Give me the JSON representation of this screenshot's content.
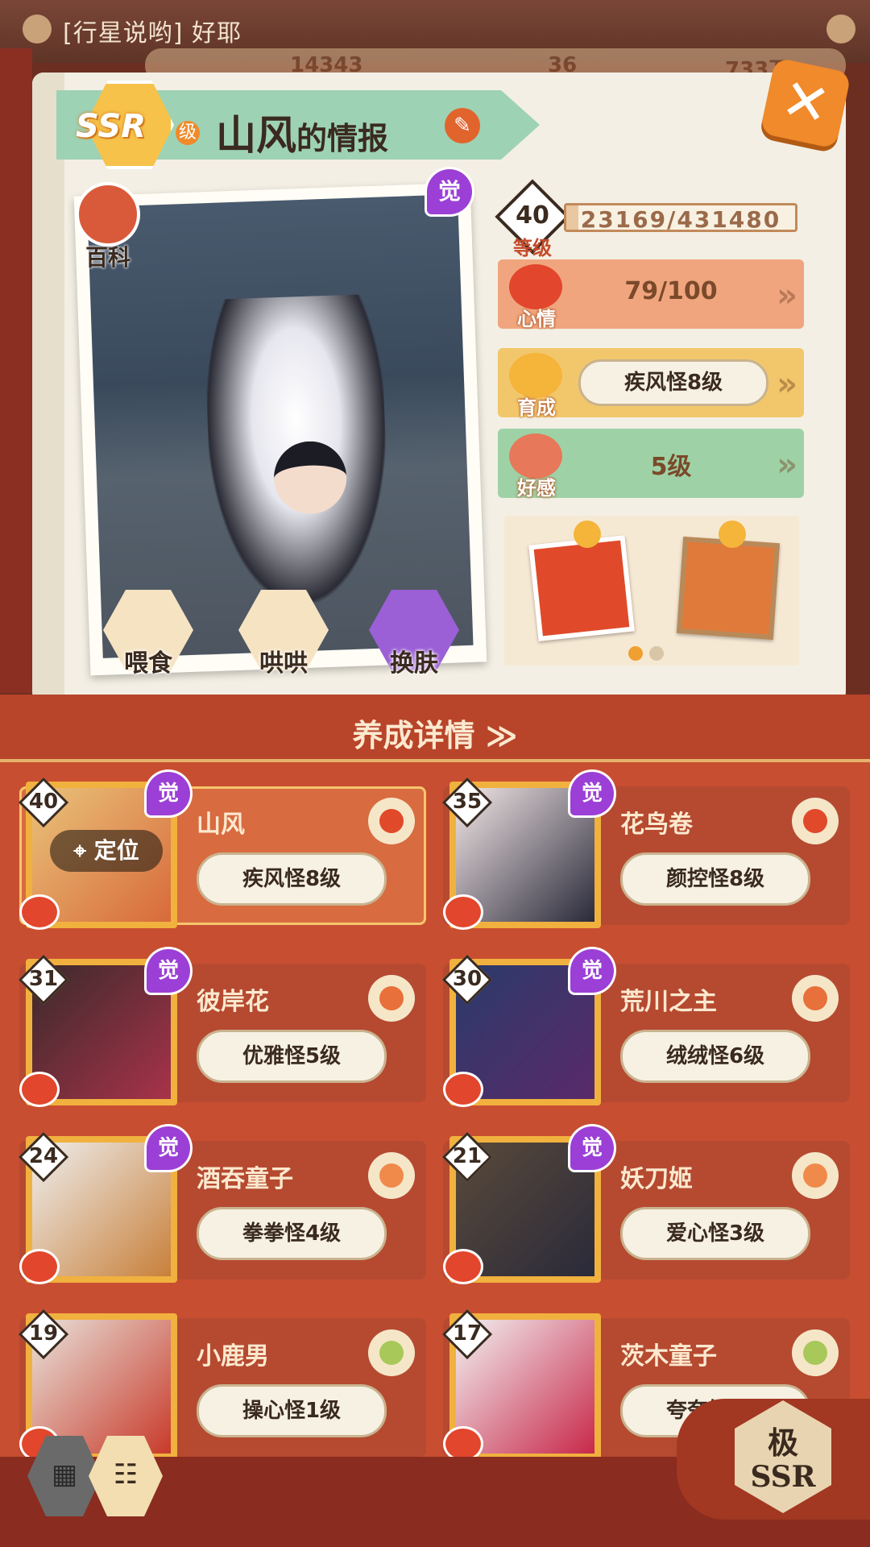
{
  "chat": {
    "text": "[行星说哟] 好耶"
  },
  "resources": {
    "a": "14343",
    "b": "36",
    "c": "733万"
  },
  "header": {
    "rank_label": "SSR",
    "rank_suffix": "级",
    "title_main": "山风",
    "title_tail": "的情报"
  },
  "portrait": {
    "awaken_label": "觉",
    "baike_label": "百科"
  },
  "actions": [
    {
      "label": "喂食"
    },
    {
      "label": "哄哄"
    },
    {
      "label": "换肤"
    }
  ],
  "level": {
    "value": "40",
    "label": "等级",
    "exp_text": "23169/431480",
    "exp_current": 23169,
    "exp_max": 431480
  },
  "stats": {
    "mood": {
      "label": "心情",
      "value": "79/100"
    },
    "growth": {
      "label": "育成",
      "value": "疾风怪8级"
    },
    "affection": {
      "label": "好感",
      "value": "5级"
    }
  },
  "section": {
    "title": "养成详情 ≫"
  },
  "shikigami": [
    {
      "name": "山风",
      "level": "40",
      "trait": "疾风怪8级",
      "awakened": "觉",
      "locate": "定位"
    },
    {
      "name": "花鸟卷",
      "level": "35",
      "trait": "颜控怪8级",
      "awakened": "觉"
    },
    {
      "name": "彼岸花",
      "level": "31",
      "trait": "优雅怪5级",
      "awakened": "觉"
    },
    {
      "name": "荒川之主",
      "level": "30",
      "trait": "绒绒怪6级",
      "awakened": "觉"
    },
    {
      "name": "酒吞童子",
      "level": "24",
      "trait": "拳拳怪4级",
      "awakened": "觉"
    },
    {
      "name": "妖刀姬",
      "level": "21",
      "trait": "爱心怪3级",
      "awakened": "觉"
    },
    {
      "name": "小鹿男",
      "level": "19",
      "trait": "操心怪1级"
    },
    {
      "name": "茨木童子",
      "level": "17",
      "trait": "夸夸怪1级"
    }
  ],
  "tab": {
    "line1": "极",
    "line2": "SSR"
  },
  "colors": {
    "accent": "#f08a2a",
    "awaken": "#9b3fd6",
    "section_bg": "#c84e31"
  }
}
